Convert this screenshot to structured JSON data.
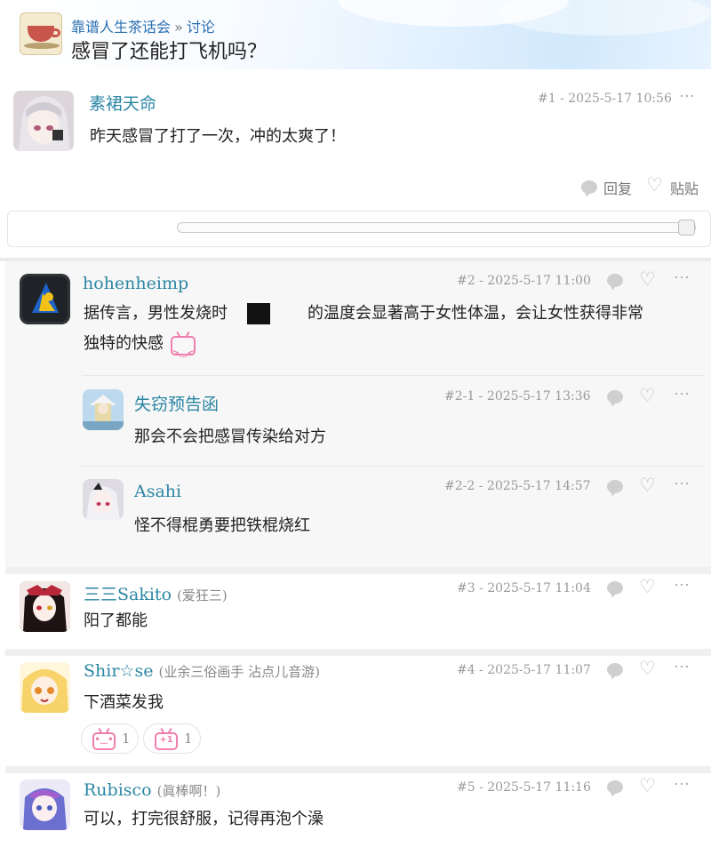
{
  "header": {
    "forum_name": "靠谱人生茶话会",
    "separator": "»",
    "category": "讨论",
    "title": "感冒了还能打飞机吗？"
  },
  "op": {
    "username": "素裙天命",
    "meta": "#1 - 2025-5-17 10:56",
    "content": "昨天感冒了打了一次，冲的太爽了！",
    "reply_label": "回复",
    "sticker_label": "贴贴"
  },
  "replies": [
    {
      "username": "hohenheimp",
      "meta": "#2 - 2025-5-17 11:00",
      "content_line1_a": "据传言，男性发烧时",
      "content_line1_b": "的温度会显著高于女性体温，会让女性获得非常",
      "content_line2": "独特的快感",
      "subreplies": [
        {
          "username": "失窃预告函",
          "meta": "#2-1 - 2025-5-17 13:36",
          "content": "那会不会把感冒传染给对方"
        },
        {
          "username": "Asahi",
          "meta": "#2-2 - 2025-5-17 14:57",
          "content": "怪不得棍勇要把铁棍烧红"
        }
      ]
    },
    {
      "username": "三三Sakito",
      "note": "(爱狂三)",
      "meta": "#3 - 2025-5-17 11:04",
      "content": "阳了都能"
    },
    {
      "username": "Shir☆se",
      "note": "(业余三俗画手 沾点儿音游)",
      "meta": "#4 - 2025-5-17 11:07",
      "content": "下酒菜发我",
      "reactions": [
        {
          "icon": "tv-smile-icon",
          "count": "1"
        },
        {
          "icon": "tv-plus-one-icon",
          "count": "1"
        }
      ]
    },
    {
      "username": "Rubisco",
      "note": "(眞棒啊！)",
      "meta": "#5 - 2025-5-17 11:16",
      "content": "可以，打完很舒服，记得再泡个澡"
    }
  ],
  "icons": {
    "more": "⋯",
    "heart": "♡"
  },
  "colors": {
    "username": "#2b86a4",
    "link": "#2a6fb0",
    "reaction_pink": "#ef7fae"
  }
}
